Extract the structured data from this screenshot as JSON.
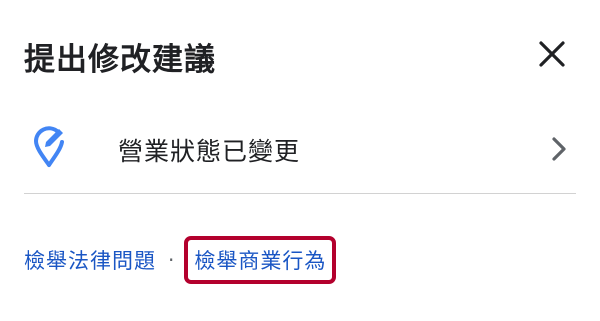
{
  "dialog": {
    "title": "提出修改建議",
    "close_icon": "close-icon"
  },
  "option": {
    "icon": "pin-edit-icon",
    "label": "營業狀態已變更",
    "chevron_icon": "chevron-right-icon"
  },
  "footer": {
    "legal_link": "檢舉法律問題",
    "separator": "·",
    "business_link": "檢舉商業行為"
  },
  "colors": {
    "accent": "#4285f4",
    "link": "#1a56c4",
    "highlight_border": "#b3002d"
  }
}
